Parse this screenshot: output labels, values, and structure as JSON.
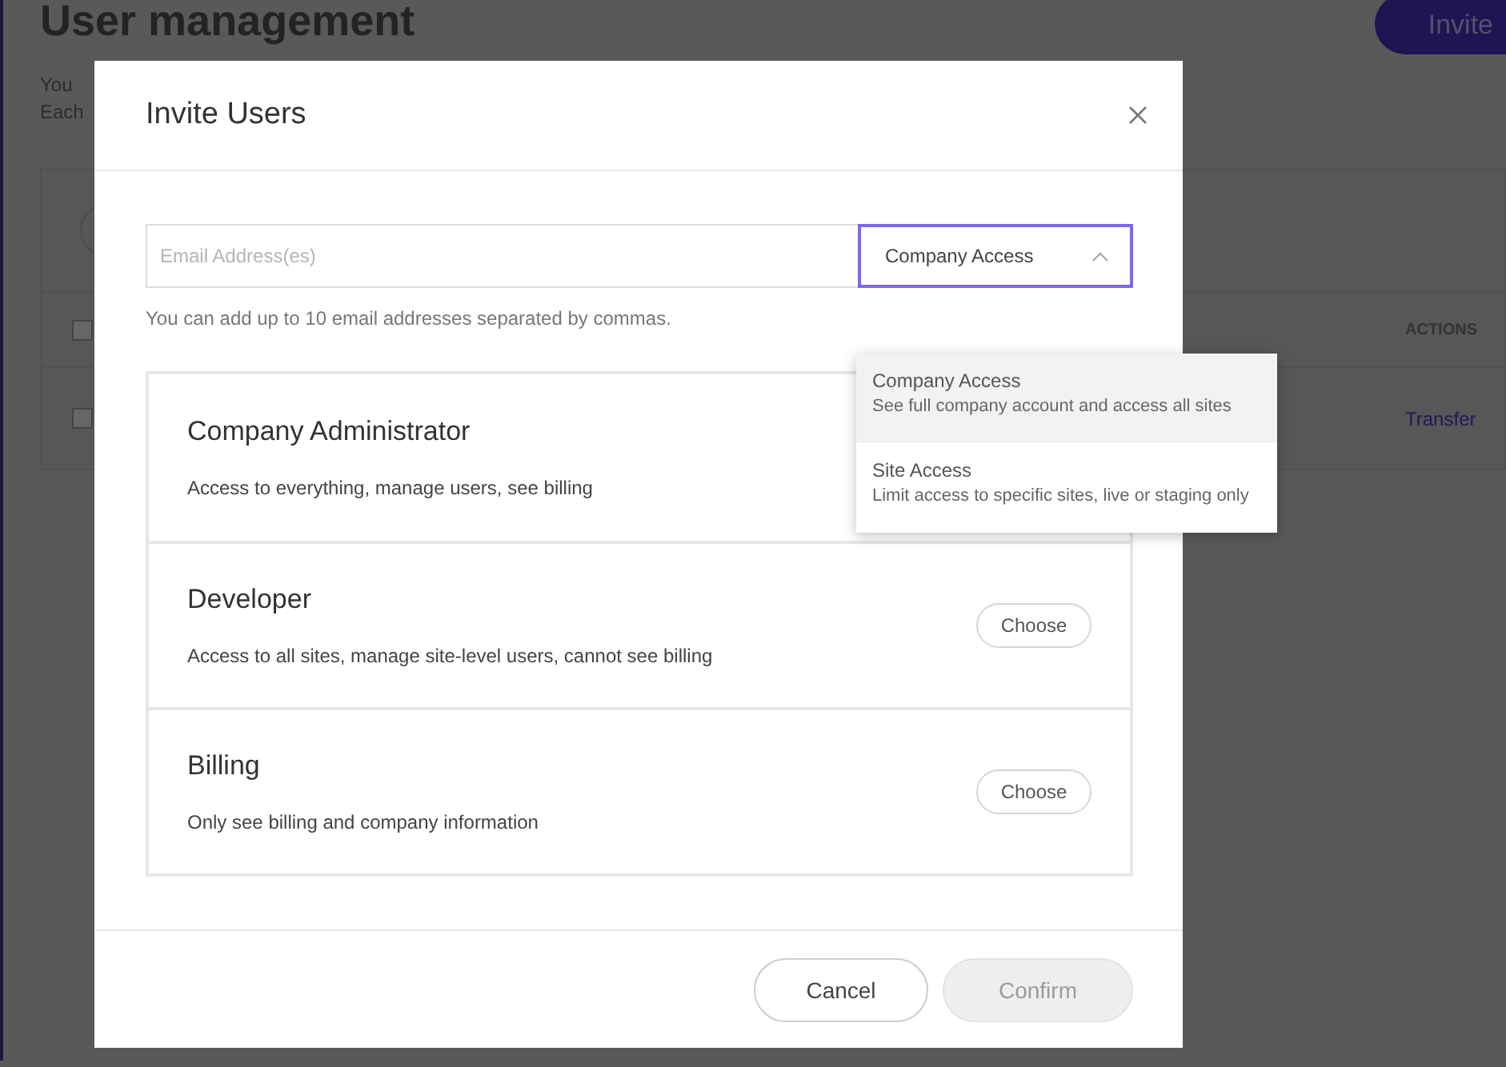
{
  "page": {
    "title": "User management",
    "invite_button": "Invite",
    "intro": [
      "You",
      "Each"
    ],
    "table": {
      "header_checked": false,
      "columns": [
        {
          "label": "ACTIONS"
        }
      ],
      "rows": [
        {
          "checked": false,
          "action": "Transfer"
        }
      ]
    }
  },
  "modal": {
    "title": "Invite Users",
    "email": {
      "placeholder": "Email Address(es)"
    },
    "access": {
      "value": "Company Access",
      "expanded": true,
      "options": [
        {
          "title": "Company Access",
          "description": "See full company account and access all sites",
          "selected": true
        },
        {
          "title": "Site Access",
          "description": "Limit access to specific sites, live or staging only",
          "selected": false
        }
      ]
    },
    "hint": "You can add up to 10 email addresses separated by commas.",
    "roles": [
      {
        "name": "Company Administrator",
        "description": "Access to everything, manage users, see billing"
      },
      {
        "name": "Developer",
        "description": "Access to all sites, manage site-level users, cannot see billing",
        "button": "Choose"
      },
      {
        "name": "Billing",
        "description": "Only see billing and company information",
        "button": "Choose"
      }
    ],
    "buttons": [
      {
        "label": "Cancel",
        "disabled": false
      },
      {
        "label": "Confirm",
        "disabled": true
      }
    ]
  }
}
